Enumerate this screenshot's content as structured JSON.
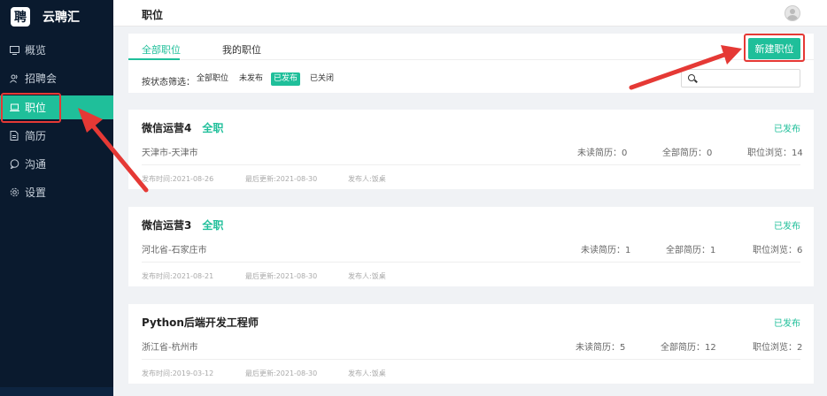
{
  "brand": {
    "logo_text": "聘",
    "name": "云聘汇"
  },
  "sidebar": {
    "items": [
      {
        "label": "概览",
        "icon": "monitor-icon"
      },
      {
        "label": "招聘会",
        "icon": "people-icon"
      },
      {
        "label": "职位",
        "icon": "laptop-icon",
        "active": true
      },
      {
        "label": "简历",
        "icon": "document-icon"
      },
      {
        "label": "沟通",
        "icon": "chat-icon"
      },
      {
        "label": "设置",
        "icon": "gear-icon"
      }
    ]
  },
  "header": {
    "title": "职位"
  },
  "tabs": [
    {
      "label": "全部职位",
      "active": true
    },
    {
      "label": "我的职位",
      "active": false
    }
  ],
  "filter": {
    "label": "按状态筛选：",
    "options": [
      {
        "label": "全部职位",
        "active": false
      },
      {
        "label": "未发布",
        "active": false
      },
      {
        "label": "已发布",
        "active": true
      },
      {
        "label": "已关闭",
        "active": false
      }
    ],
    "search_placeholder": "",
    "search_value": ""
  },
  "actions": {
    "new_job": "新建职位"
  },
  "jobs": [
    {
      "title": "微信运营4",
      "type": "全职",
      "status": "已发布",
      "location": "天津市-天津市",
      "unread": "未读简历：0",
      "total": "全部简历：0",
      "views": "职位浏览：14",
      "published": "发布时间:2021-08-26",
      "updated": "最后更新:2021-08-30",
      "publisher": "发布人:饭桌"
    },
    {
      "title": "微信运营3",
      "type": "全职",
      "status": "已发布",
      "location": "河北省-石家庄市",
      "unread": "未读简历：1",
      "total": "全部简历：1",
      "views": "职位浏览：6",
      "published": "发布时间:2021-08-21",
      "updated": "最后更新:2021-08-30",
      "publisher": "发布人:饭桌"
    },
    {
      "title": "Python后端开发工程师",
      "type": "",
      "status": "已发布",
      "location": "浙江省-杭州市",
      "unread": "未读简历：5",
      "total": "全部简历：12",
      "views": "职位浏览：2",
      "published": "发布时间:2019-03-12",
      "updated": "最后更新:2021-08-30",
      "publisher": "发布人:饭桌"
    }
  ],
  "colors": {
    "accent": "#1fbf9a",
    "sidebar": "#0a1a2e",
    "annotation": "#e53935"
  }
}
